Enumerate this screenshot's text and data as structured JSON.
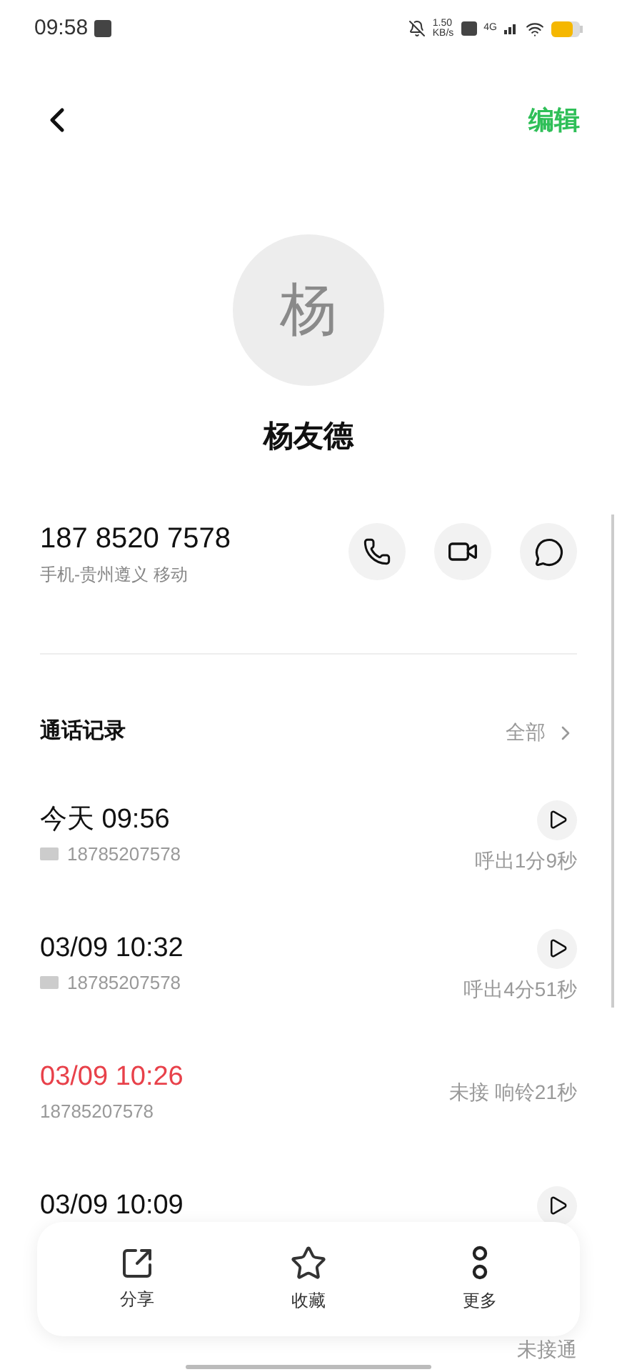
{
  "status_bar": {
    "time": "09:58",
    "speed": "1.50",
    "speed_unit": "KB/s",
    "network": "4G"
  },
  "header": {
    "edit": "编辑"
  },
  "contact": {
    "avatar": "杨",
    "name": "杨友德",
    "phone": "187 8520 7578",
    "location": "手机-贵州遵义 移动"
  },
  "call_log": {
    "title": "通话记录",
    "all": "全部",
    "rows": [
      {
        "time": "今天 09:56",
        "number": "18785207578",
        "detail": "呼出1分9秒",
        "missed": false,
        "recording": true,
        "sim": true
      },
      {
        "time": "03/09 10:32",
        "number": "18785207578",
        "detail": "呼出4分51秒",
        "missed": false,
        "recording": true,
        "sim": true
      },
      {
        "time": "03/09 10:26",
        "number": "18785207578",
        "detail": "未接 响铃21秒",
        "missed": true
      },
      {
        "time": "03/09 10:09",
        "recording": true,
        "missed": false
      },
      {
        "detail": "未接通"
      }
    ]
  },
  "actions": [
    {
      "kind": "share",
      "label": "分享"
    },
    {
      "kind": "favorite",
      "label": "收藏"
    },
    {
      "kind": "more",
      "label": "更多"
    }
  ]
}
